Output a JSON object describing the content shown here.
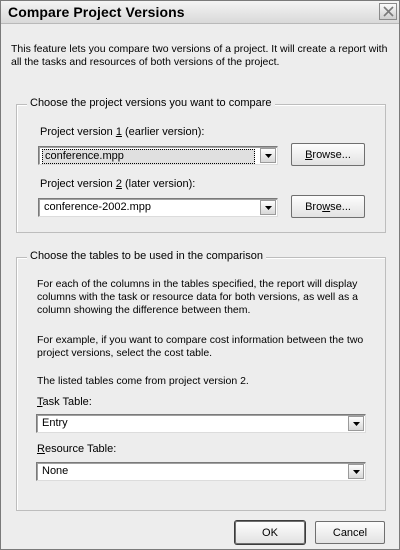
{
  "dialog": {
    "title": "Compare Project Versions",
    "intro": "This feature lets you compare two versions of a project. It will create a report with all the tasks and resources of both versions of the project."
  },
  "versions_group": {
    "legend": "Choose the project versions you want to compare",
    "version1": {
      "label_pre": "Project version ",
      "label_key": "1",
      "label_post": " (earlier version):",
      "value": "conference.mpp",
      "browse_label_key": "B",
      "browse_label_rest": "rowse..."
    },
    "version2": {
      "label_pre": "Project version ",
      "label_key": "2",
      "label_post": " (later version):",
      "value": "conference-2002.mpp",
      "browse_label_pre": "Bro",
      "browse_label_key": "w",
      "browse_label_post": "se..."
    }
  },
  "tables_group": {
    "legend": "Choose the tables to be used in the comparison",
    "para1": "For each of the columns in the tables specified, the report will display columns with the task or resource data for both versions, as well as a column showing the difference between them.",
    "para2": "For example, if you want to compare cost information between the two project versions, select the cost table.",
    "para3": "The listed tables come from project version 2.",
    "task_table": {
      "label_key": "T",
      "label_rest": "ask Table:",
      "value": "Entry"
    },
    "resource_table": {
      "label_key": "R",
      "label_rest": "esource Table:",
      "value": "None"
    }
  },
  "buttons": {
    "ok": "OK",
    "cancel": "Cancel"
  }
}
